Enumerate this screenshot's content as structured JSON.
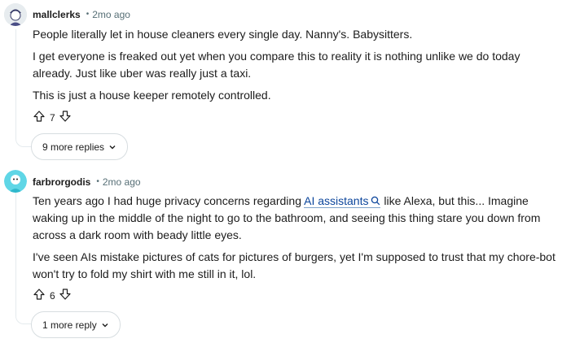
{
  "comments": [
    {
      "username": "mallclerks",
      "time": "2mo ago",
      "paragraphs": [
        "People literally let in house cleaners every single day. Nanny's. Babysitters.",
        "I get everyone is freaked out yet when you compare this to reality it is nothing unlike we do today already. Just like uber was really just a taxi.",
        "This is just a house keeper remotely controlled."
      ],
      "votes": "7",
      "more_replies": "9 more replies"
    },
    {
      "username": "farbrorgodis",
      "time": "2mo ago",
      "paragraph1_before": "Ten years ago I had huge privacy concerns regarding ",
      "keyword": "AI assistants",
      "paragraph1_after": " like Alexa, but this... Imagine waking up in the middle of the night to go to the bathroom, and seeing this thing stare you down from across a dark room with beady little eyes.",
      "paragraph2": "I've seen AIs mistake pictures of cats for pictures of burgers, yet I'm supposed to trust that my chore-bot won't try to fold my shirt with me still in it, lol.",
      "votes": "6",
      "more_replies": "1 more reply"
    }
  ],
  "icons": [
    "upvote-icon",
    "downvote-icon",
    "chevron-down-icon",
    "search-icon"
  ],
  "colors": {
    "link": "#0a449b",
    "meta": "#576f76",
    "border": "#d7dde0"
  }
}
